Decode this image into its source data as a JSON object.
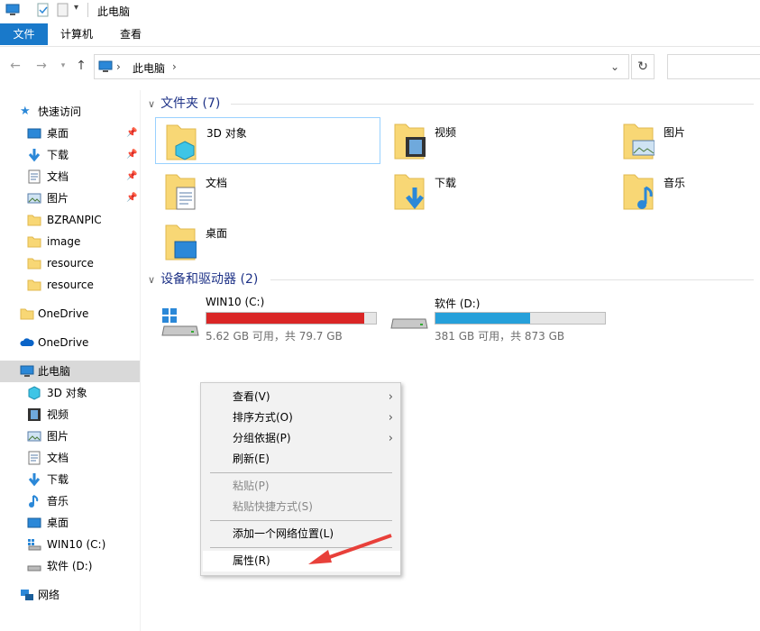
{
  "window": {
    "title": "此电脑"
  },
  "ribbon": {
    "file": "文件",
    "tab_computer": "计算机",
    "tab_view": "查看"
  },
  "address": {
    "crumb": "此电脑"
  },
  "sidebar": {
    "quick_access": "快速访问",
    "items": [
      {
        "label": "桌面"
      },
      {
        "label": "下载"
      },
      {
        "label": "文档"
      },
      {
        "label": "图片"
      },
      {
        "label": "BZRANPIC"
      },
      {
        "label": "image"
      },
      {
        "label": "resource"
      },
      {
        "label": "resource"
      }
    ],
    "onedrive1": "OneDrive",
    "onedrive2": "OneDrive",
    "this_pc": "此电脑",
    "pc_items": [
      {
        "label": "3D 对象"
      },
      {
        "label": "视频"
      },
      {
        "label": "图片"
      },
      {
        "label": "文档"
      },
      {
        "label": "下载"
      },
      {
        "label": "音乐"
      },
      {
        "label": "桌面"
      },
      {
        "label": "WIN10 (C:)"
      },
      {
        "label": "软件 (D:)"
      }
    ],
    "network": "网络"
  },
  "groups": {
    "folders": "文件夹 (7)",
    "devices": "设备和驱动器 (2)"
  },
  "folders": [
    {
      "label": "3D 对象"
    },
    {
      "label": "视频"
    },
    {
      "label": "图片"
    },
    {
      "label": "文档"
    },
    {
      "label": "下载"
    },
    {
      "label": "音乐"
    },
    {
      "label": "桌面"
    }
  ],
  "drives": [
    {
      "name": "WIN10 (C:)",
      "status": "5.62 GB 可用，共 79.7 GB",
      "used_fraction": 0.93,
      "color": "#da2626"
    },
    {
      "name": "软件 (D:)",
      "status": "381 GB 可用，共 873 GB",
      "used_fraction": 0.56,
      "color": "#26a0da"
    }
  ],
  "context_menu": {
    "view": "查看(V)",
    "sort": "排序方式(O)",
    "group": "分组依据(P)",
    "refresh": "刷新(E)",
    "paste": "粘贴(P)",
    "paste_shortcut": "粘贴快捷方式(S)",
    "add_network": "添加一个网络位置(L)",
    "properties": "属性(R)"
  },
  "colors": {
    "accent": "#1979ca",
    "arrow": "#e8403a"
  }
}
